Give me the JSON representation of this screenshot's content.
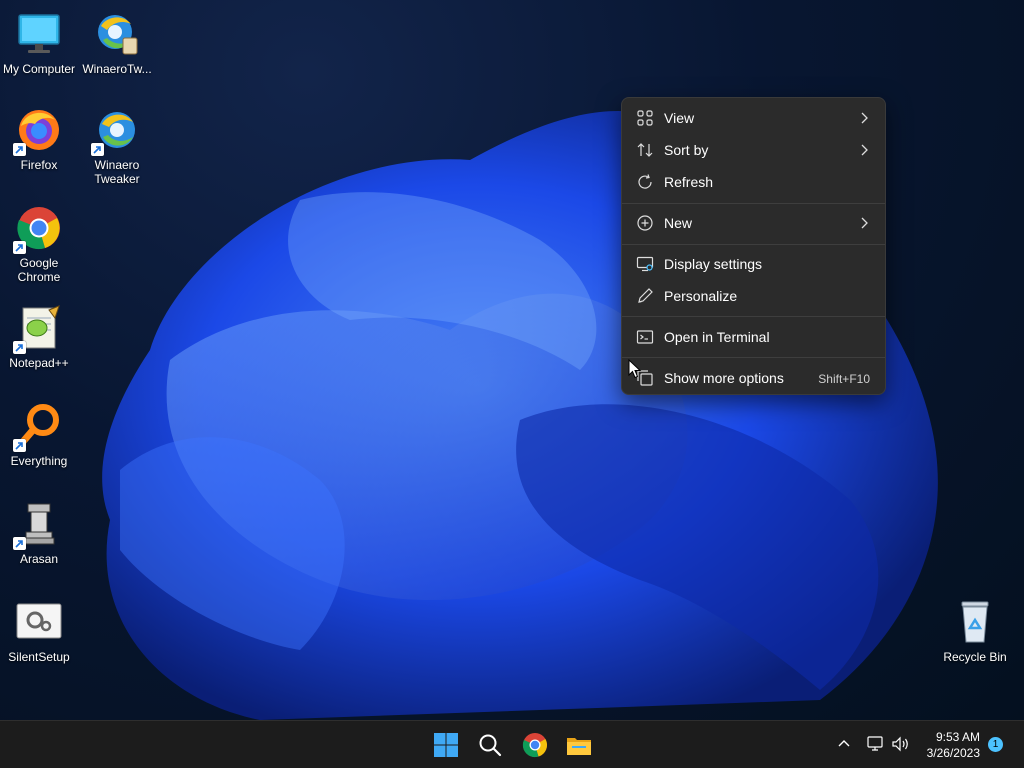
{
  "desktop_icons": [
    {
      "name": "My Computer",
      "icon": "monitor-icon",
      "shortcut": false
    },
    {
      "name": "WinaeroTw...",
      "icon": "winaero-tweaker-icon",
      "shortcut": false
    },
    {
      "name": "Firefox",
      "icon": "firefox-icon",
      "shortcut": true
    },
    {
      "name": "Winaero Tweaker",
      "icon": "winaero-tweaker-icon",
      "shortcut": true
    },
    {
      "name": "Google Chrome",
      "icon": "chrome-icon",
      "shortcut": true
    },
    {
      "name": "Notepad++",
      "icon": "notepadpp-icon",
      "shortcut": true
    },
    {
      "name": "Everything",
      "icon": "everything-search-icon",
      "shortcut": true
    },
    {
      "name": "Arasan",
      "icon": "chess-rook-icon",
      "shortcut": true
    },
    {
      "name": "SilentSetup",
      "icon": "setup-gear-icon",
      "shortcut": false
    },
    {
      "name": "Recycle Bin",
      "icon": "recycle-bin-icon",
      "shortcut": false
    }
  ],
  "context_menu": {
    "items": [
      {
        "label": "View",
        "icon": "view-grid-icon",
        "submenu": true,
        "shortcut": ""
      },
      {
        "label": "Sort by",
        "icon": "sort-arrows-icon",
        "submenu": true,
        "shortcut": ""
      },
      {
        "label": "Refresh",
        "icon": "refresh-icon",
        "submenu": false,
        "shortcut": ""
      },
      {
        "label": "New",
        "icon": "new-plus-icon",
        "submenu": true,
        "shortcut": ""
      },
      {
        "label": "Display settings",
        "icon": "display-settings-icon",
        "submenu": false,
        "shortcut": ""
      },
      {
        "label": "Personalize",
        "icon": "pen-icon",
        "submenu": false,
        "shortcut": ""
      },
      {
        "label": "Open in Terminal",
        "icon": "terminal-icon",
        "submenu": false,
        "shortcut": ""
      },
      {
        "label": "Show more options",
        "icon": "more-options-icon",
        "submenu": false,
        "shortcut": "Shift+F10"
      }
    ]
  },
  "taskbar": {
    "pinned": [
      "start-icon",
      "search-icon",
      "chrome-icon",
      "file-explorer-icon"
    ],
    "tray": {
      "time": "9:53 AM",
      "date": "3/26/2023",
      "notification_count": "1"
    }
  },
  "colors": {
    "menu_bg": "#2b2b2b",
    "taskbar_bg": "#1c1c1c",
    "accent": "#4cc2ff",
    "wallpaper_blue": "#1f4fff"
  }
}
